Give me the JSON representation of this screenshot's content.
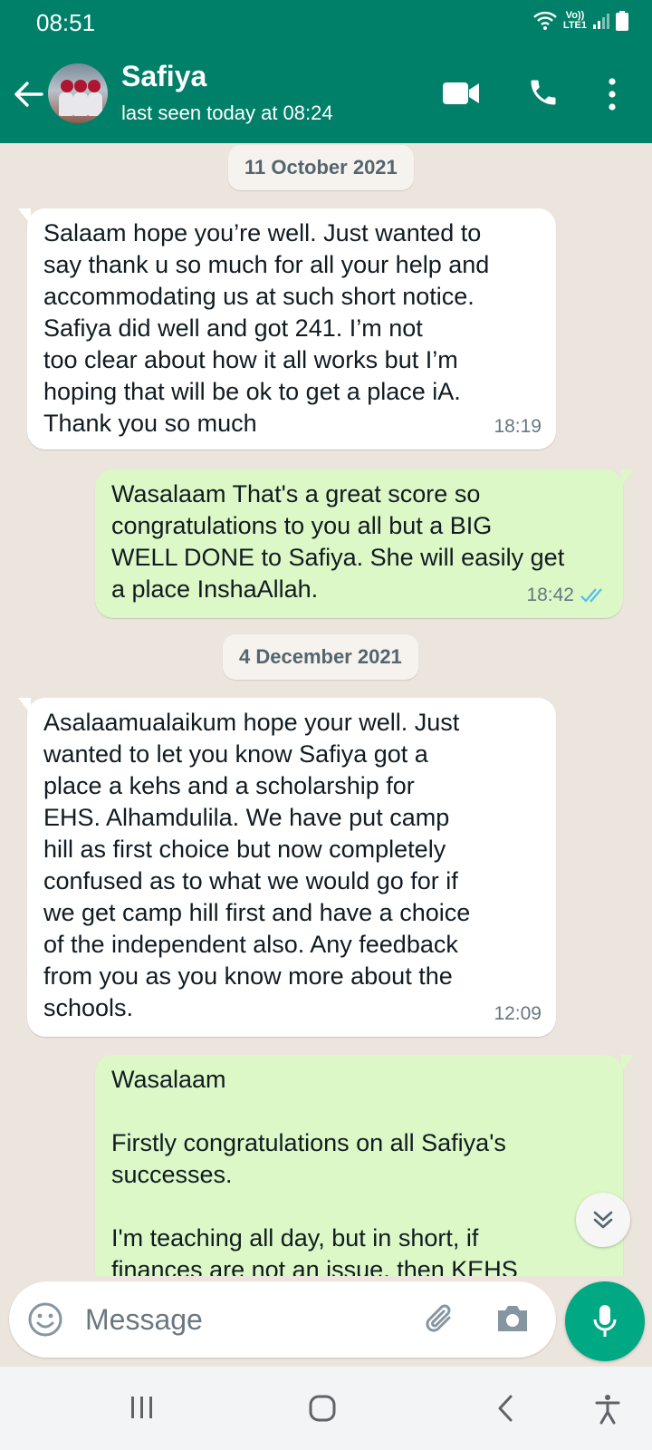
{
  "status_bar": {
    "time": "08:51",
    "network_line1": "Vo))",
    "network_line2": "LTE1"
  },
  "header": {
    "contact_name": "Safiya",
    "last_seen": "last seen today at 08:24"
  },
  "conversation": {
    "date_1": "11 October 2021",
    "msg_1": {
      "text": "Salaam hope you’re well. Just wanted to\nsay thank u so much for all your help and\naccommodating us at such short notice.\nSafiya did well and got 241. I’m not\ntoo clear about how it all works but I’m\nhoping that will be ok to get a place iA.\nThank you so much",
      "time": "18:19"
    },
    "msg_2": {
      "text": "Wasalaam That's a great score so\ncongratulations to you all but a BIG\nWELL DONE to Safiya. She will easily get\na place InshaAllah.",
      "time": "18:42"
    },
    "date_2": "4 December 2021",
    "msg_3": {
      "text": "Asalaamualaikum hope your well. Just\nwanted to let you know Safiya got a\nplace a kehs and a scholarship for\nEHS. Alhamdulila. We have put camp\nhill as first choice but now completely\nconfused as to what we would go for if\nwe get camp hill first and have a choice\nof the independent also. Any feedback\nfrom you as you know more about the\nschools.",
      "time": "12:09"
    },
    "msg_4": {
      "text": "Wasalaam\n\nFirstly congratulations on all Safiya's\nsuccesses.\n\nI'm teaching all day, but in short, if\nfinances are not an issue, then KEHS"
    }
  },
  "composer": {
    "placeholder": "Message"
  },
  "colors": {
    "header": "#008069",
    "outgoing_bubble": "#dcf8c6",
    "incoming_bubble": "#ffffff",
    "mic_button": "#00a884",
    "read_ticks": "#53bdeb"
  }
}
